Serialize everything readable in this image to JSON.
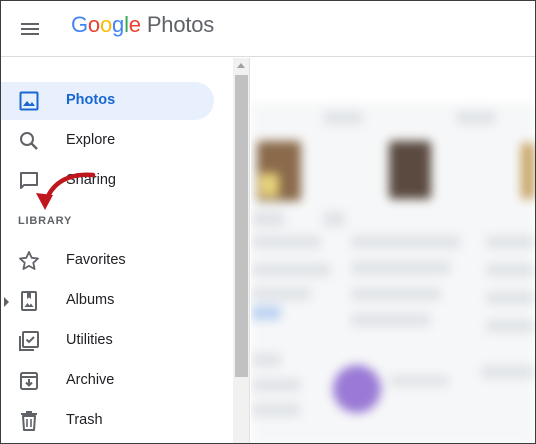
{
  "header": {
    "logo_letters": [
      {
        "ch": "G",
        "color": "#4285F4"
      },
      {
        "ch": "o",
        "color": "#EA4335"
      },
      {
        "ch": "o",
        "color": "#FBBC05"
      },
      {
        "ch": "g",
        "color": "#4285F4"
      },
      {
        "ch": "l",
        "color": "#34A853"
      },
      {
        "ch": "e",
        "color": "#EA4335"
      }
    ],
    "product": "Photos",
    "menu_icon": "hamburger-menu-icon"
  },
  "sidebar": {
    "items": [
      {
        "label": "Photos",
        "icon": "photo-icon",
        "active": true
      },
      {
        "label": "Explore",
        "icon": "search-icon",
        "active": false
      },
      {
        "label": "Sharing",
        "icon": "chat-bubble-icon",
        "active": false
      },
      {
        "label": "Favorites",
        "icon": "star-icon",
        "active": false
      },
      {
        "label": "Albums",
        "icon": "album-icon",
        "active": false
      },
      {
        "label": "Utilities",
        "icon": "checkbox-icon",
        "active": false
      },
      {
        "label": "Archive",
        "icon": "archive-icon",
        "active": false
      },
      {
        "label": "Trash",
        "icon": "trash-icon",
        "active": false
      }
    ],
    "section_label": "LIBRARY"
  },
  "colors": {
    "accent": "#1967d2",
    "active_bg": "#e8f0fe",
    "annotation_arrow": "#c0161d"
  }
}
